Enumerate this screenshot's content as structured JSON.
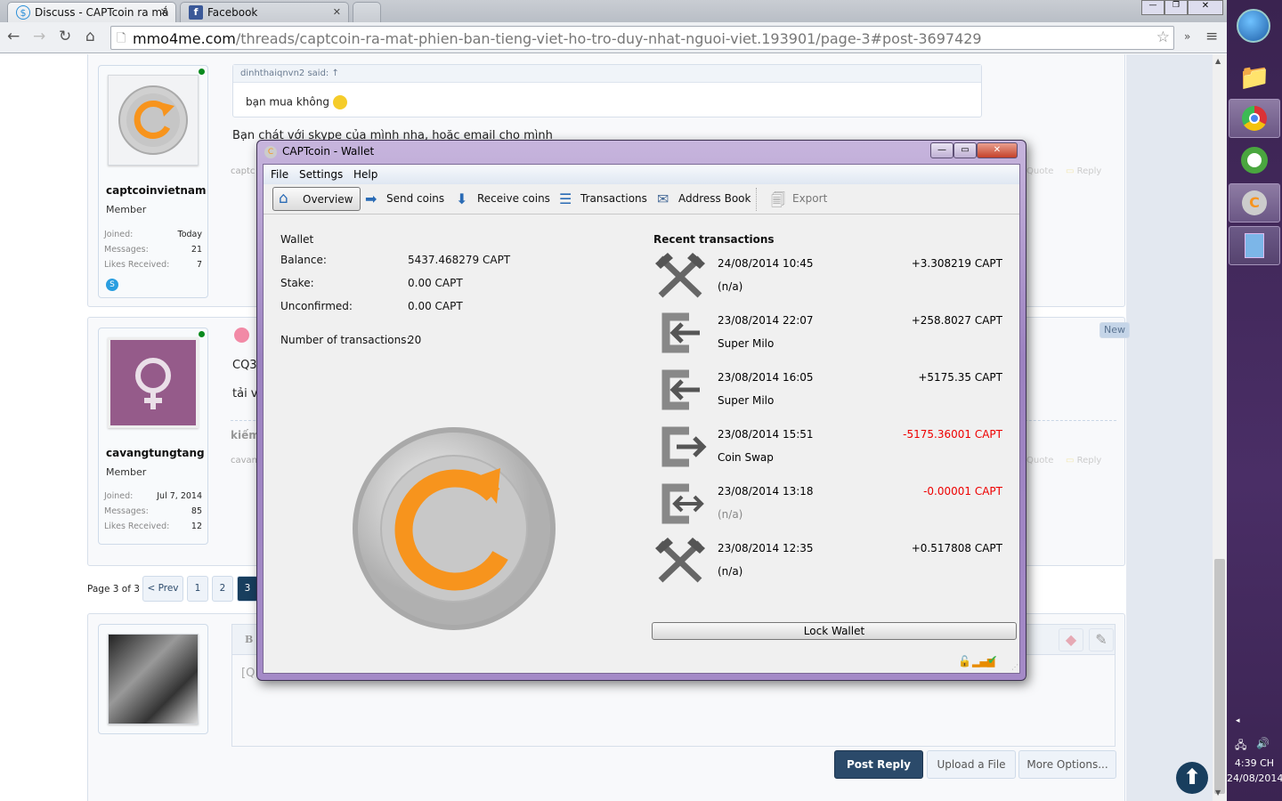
{
  "browser": {
    "tabs": [
      {
        "title": "Discuss - CAPTcoin ra mắ",
        "active": true
      },
      {
        "title": "Facebook",
        "active": false
      }
    ],
    "url_host": "mmo4me.com",
    "url_path": "/threads/captcoin-ra-mat-phien-ban-tieng-viet-ho-tro-duy-nhat-nguoi-viet.193901/page-3#post-3697429"
  },
  "forum": {
    "posts": [
      {
        "username": "captcoinvietnam",
        "role": "Member",
        "joined": "Today",
        "messages": "21",
        "likes": "7",
        "quote_author": "dinhthaiqnvn2 said: ↑",
        "quote_text": "bạn mua không",
        "body": "Bạn chát với skype của mình nha, hoặc email cho mình",
        "sig": "captc",
        "quote": "Quote",
        "reply": "Reply"
      },
      {
        "username": "cavangtungtang",
        "role": "Member",
        "joined": "Jul 7, 2014",
        "messages": "85",
        "likes": "12",
        "line1": "CQ3",
        "line2": "tải ví",
        "sig_title": "kiếm",
        "sig": "cavan",
        "badge": "New",
        "quote": "Quote",
        "reply": "Reply"
      }
    ],
    "labels": {
      "joined": "Joined:",
      "messages": "Messages:",
      "likes": "Likes Received:"
    },
    "pagination": {
      "text": "Page 3 of 3",
      "prev": "< Prev",
      "pages": [
        "1",
        "2",
        "3"
      ],
      "current": "3"
    },
    "editor": {
      "placeholder_bold": "B",
      "content": "[Q",
      "post_reply": "Post Reply",
      "upload": "Upload a File",
      "more": "More Options..."
    }
  },
  "wallet": {
    "title": "CAPTcoin - Wallet",
    "menu": [
      "File",
      "Settings",
      "Help"
    ],
    "toolbar": [
      "Overview",
      "Send coins",
      "Receive coins",
      "Transactions",
      "Address Book",
      "Export"
    ],
    "overview": {
      "heading": "Wallet",
      "balance_label": "Balance:",
      "balance": "5437.468279 CAPT",
      "stake_label": "Stake:",
      "stake": "0.00 CAPT",
      "unconfirmed_label": "Unconfirmed:",
      "unconfirmed": "0.00 CAPT",
      "ntx_label": "Number of transactions:",
      "ntx": "20"
    },
    "recent_title": "Recent transactions",
    "transactions": [
      {
        "type": "mined",
        "date": "24/08/2014 10:45",
        "amount": "+3.308219 CAPT",
        "label": "(n/a)",
        "negative": false
      },
      {
        "type": "received",
        "date": "23/08/2014 22:07",
        "amount": "+258.8027 CAPT",
        "label": "Super Milo",
        "negative": false
      },
      {
        "type": "received",
        "date": "23/08/2014 16:05",
        "amount": "+5175.35 CAPT",
        "label": "Super Milo",
        "negative": false
      },
      {
        "type": "sent",
        "date": "23/08/2014 15:51",
        "amount": "-5175.36001 CAPT",
        "label": "Coin Swap",
        "negative": true
      },
      {
        "type": "self",
        "date": "23/08/2014 13:18",
        "amount": "-0.00001 CAPT",
        "label": "(n/a)",
        "negative": true
      },
      {
        "type": "mined",
        "date": "23/08/2014 12:35",
        "amount": "+0.517808 CAPT",
        "label": "(n/a)",
        "negative": false
      }
    ],
    "lock_button": "Lock Wallet"
  },
  "taskbar": {
    "time": "4:39 CH",
    "date": "24/08/2014"
  },
  "colors": {
    "accent": "#f7941d",
    "wallet_frame": "#a48ac7",
    "post_reply": "#2b4a6a",
    "negative": "#ee0000"
  }
}
